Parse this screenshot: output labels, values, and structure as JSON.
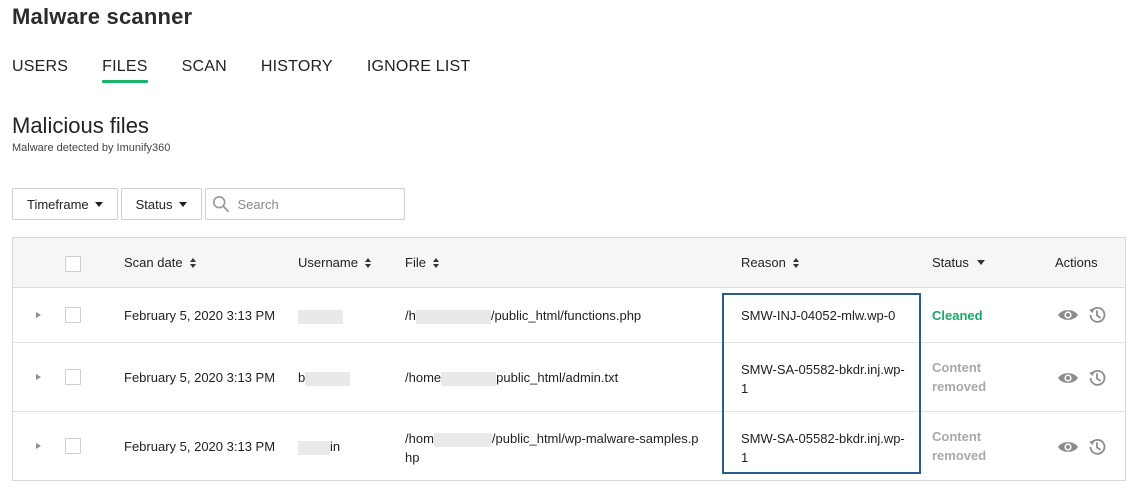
{
  "app": {
    "title": "Malware scanner"
  },
  "nav": {
    "tabs": [
      {
        "label": "USERS",
        "active": false
      },
      {
        "label": "FILES",
        "active": true
      },
      {
        "label": "SCAN",
        "active": false
      },
      {
        "label": "HISTORY",
        "active": false
      },
      {
        "label": "IGNORE LIST",
        "active": false
      }
    ]
  },
  "section": {
    "title": "Malicious files",
    "subtitle": "Malware detected by Imunify360"
  },
  "filters": {
    "timeframe_label": "Timeframe",
    "status_label": "Status",
    "search_placeholder": "Search"
  },
  "table": {
    "headers": {
      "scan_date": "Scan date",
      "username": "Username",
      "file": "File",
      "reason": "Reason",
      "status": "Status",
      "actions": "Actions"
    },
    "rows": [
      {
        "scan_date": "February 5, 2020 3:13 PM",
        "username_pre": "",
        "username_post": "",
        "file_pre": "/h",
        "file_post": "/public_html/functions.php",
        "file_line2": "",
        "reason_line1": "SMW-INJ-04052-mlw.wp-0",
        "reason_line2": "",
        "status_line1": "Cleaned",
        "status_line2": "",
        "status_type": "cleaned"
      },
      {
        "scan_date": "February 5, 2020 3:13 PM",
        "username_pre": "b",
        "username_post": "",
        "file_pre": "/home",
        "file_post": "public_html/admin.txt",
        "file_line2": "",
        "reason_line1": "SMW-SA-05582-bkdr.inj.wp-",
        "reason_line2": "1",
        "status_line1": "Content",
        "status_line2": "removed",
        "status_type": "removed"
      },
      {
        "scan_date": "February 5, 2020 3:13 PM",
        "username_pre": "",
        "username_post": "in",
        "file_pre": "/hom",
        "file_post": "/public_html/wp-malware-samples.p",
        "file_line2": "hp",
        "reason_line1": "SMW-SA-05582-bkdr.inj.wp-",
        "reason_line2": "1",
        "status_line1": "Content",
        "status_line2": "removed",
        "status_type": "removed"
      }
    ]
  },
  "colors": {
    "accent": "#19b36b",
    "cleaned": "#19a66a",
    "removed": "#a9a9a9",
    "highlight": "#2a5d8f"
  },
  "icons": {
    "search": "search-icon",
    "view": "eye-icon",
    "restore": "history-icon",
    "expand": "caret-right-icon"
  }
}
